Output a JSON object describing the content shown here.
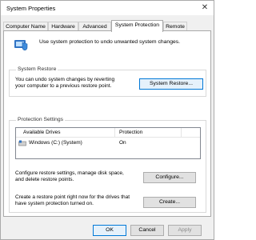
{
  "window": {
    "title": "System Properties",
    "close_glyph": "✕"
  },
  "tabs": [
    {
      "label": "Computer Name",
      "active": false
    },
    {
      "label": "Hardware",
      "active": false
    },
    {
      "label": "Advanced",
      "active": false
    },
    {
      "label": "System Protection",
      "active": true
    },
    {
      "label": "Remote",
      "active": false
    }
  ],
  "intro": {
    "icon": "shield-icon",
    "text": "Use system protection to undo unwanted system changes."
  },
  "system_restore": {
    "label": "System Restore",
    "desc_line1": "You can undo system changes by reverting",
    "desc_line2": "your computer to a previous restore point.",
    "button": "System Restore..."
  },
  "protection_settings": {
    "label": "Protection Settings",
    "columns": [
      "Available Drives",
      "Protection"
    ],
    "drives": [
      {
        "icon": "drive-icon",
        "name": "Windows (C:) (System)",
        "protection": "On"
      }
    ],
    "configure_line1": "Configure restore settings, manage disk space,",
    "configure_line2": "and delete restore points.",
    "configure_button": "Configure...",
    "create_line1": "Create a restore point right now for the drives that",
    "create_line2": "have system protection turned on.",
    "create_button": "Create..."
  },
  "footer": {
    "ok": "OK",
    "cancel": "Cancel",
    "apply": "Apply"
  }
}
